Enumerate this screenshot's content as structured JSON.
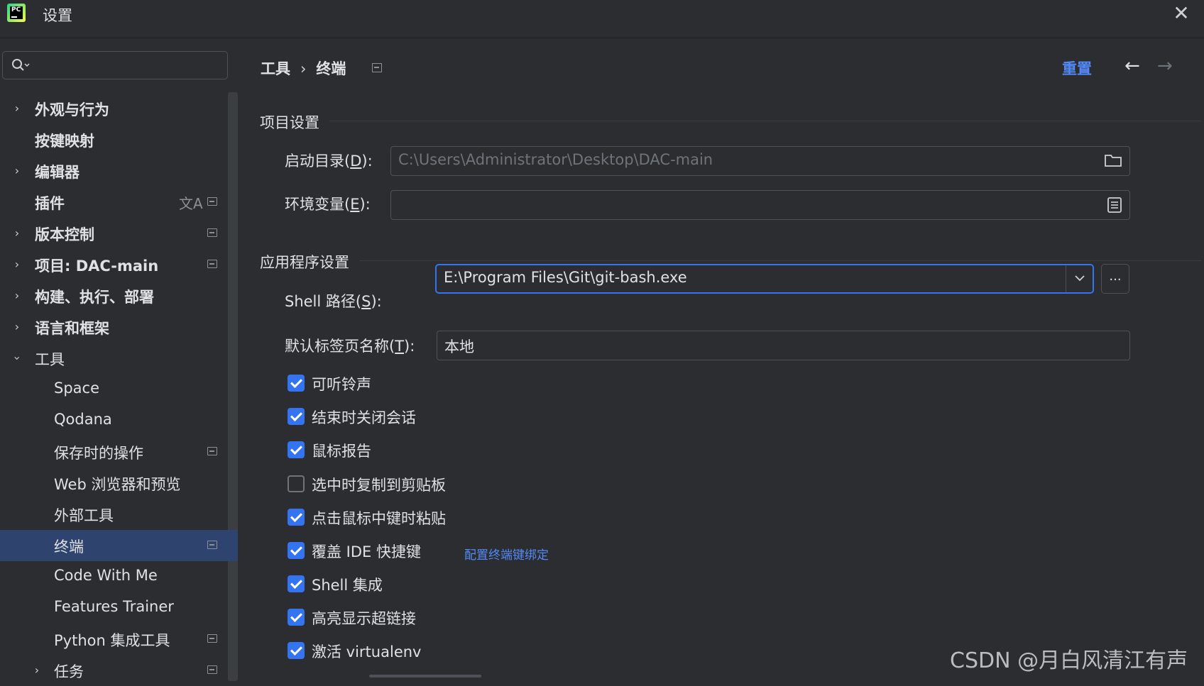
{
  "window": {
    "title": "设置",
    "app_logo_text": "PC",
    "close_icon": "close-icon"
  },
  "sidebar": {
    "search": {
      "placeholder": ""
    },
    "items": [
      {
        "label": "外观与行为",
        "expandable": true,
        "expanded": false,
        "bold": true
      },
      {
        "label": "按键映射",
        "expandable": false,
        "bold": true
      },
      {
        "label": "编辑器",
        "expandable": true,
        "expanded": false,
        "bold": true
      },
      {
        "label": "插件",
        "expandable": false,
        "bold": true
      },
      {
        "label": "版本控制",
        "expandable": true,
        "expanded": false,
        "bold": true
      },
      {
        "label": "项目: DAC-main",
        "expandable": true,
        "expanded": false,
        "bold": true
      },
      {
        "label": "构建、执行、部署",
        "expandable": true,
        "expanded": false,
        "bold": true
      },
      {
        "label": "语言和框架",
        "expandable": true,
        "expanded": false,
        "bold": true
      },
      {
        "label": "工具",
        "expandable": true,
        "expanded": true,
        "bold": false
      },
      {
        "label": "Space"
      },
      {
        "label": "Qodana"
      },
      {
        "label": "保存时的操作"
      },
      {
        "label": "Web 浏览器和预览"
      },
      {
        "label": "外部工具"
      },
      {
        "label": "终端",
        "selected": true
      },
      {
        "label": "Code With Me"
      },
      {
        "label": "Features Trainer"
      },
      {
        "label": "Python 集成工具"
      },
      {
        "label": "任务",
        "expandable": true,
        "expanded": false
      }
    ]
  },
  "main": {
    "breadcrumb": {
      "parent": "工具",
      "separator": "›",
      "current": "终端"
    },
    "reset_label": "重置",
    "project_section": {
      "title": "项目设置",
      "start_dir_label": "启动目录(",
      "start_dir_mnemonic": "D",
      "start_dir_suffix": "):",
      "start_dir_value": "C:\\Users\\Administrator\\Desktop\\DAC-main",
      "env_label": "环境变量(",
      "env_mnemonic": "E",
      "env_suffix": "):",
      "env_value": ""
    },
    "app_section": {
      "title": "应用程序设置",
      "shell_label": "Shell 路径(",
      "shell_mnemonic": "S",
      "shell_suffix": "):",
      "shell_value": "E:\\Program Files\\Git\\git-bash.exe",
      "browse_label": "...",
      "tab_name_label": "默认标签页名称(",
      "tab_name_mnemonic": "T",
      "tab_name_suffix": "):",
      "tab_name_value": "本地"
    },
    "checkboxes": [
      {
        "label": "可听铃声",
        "checked": true
      },
      {
        "label": "结束时关闭会话",
        "checked": true
      },
      {
        "label": "鼠标报告",
        "checked": true
      },
      {
        "label": "选中时复制到剪贴板",
        "checked": false
      },
      {
        "label": "点击鼠标中键时粘贴",
        "checked": true
      },
      {
        "label": "覆盖 IDE 快捷键",
        "checked": true,
        "link": "配置终端键绑定"
      },
      {
        "label": "Shell 集成",
        "checked": true
      },
      {
        "label": "高亮显示超链接",
        "checked": true
      },
      {
        "label": "激活 virtualenv",
        "checked": true
      }
    ]
  },
  "watermark": "CSDN @月白风清江有声",
  "colors": {
    "accent": "#3574f0",
    "link": "#548af7",
    "background": "#2b2d30",
    "selected": "#2e436e"
  }
}
